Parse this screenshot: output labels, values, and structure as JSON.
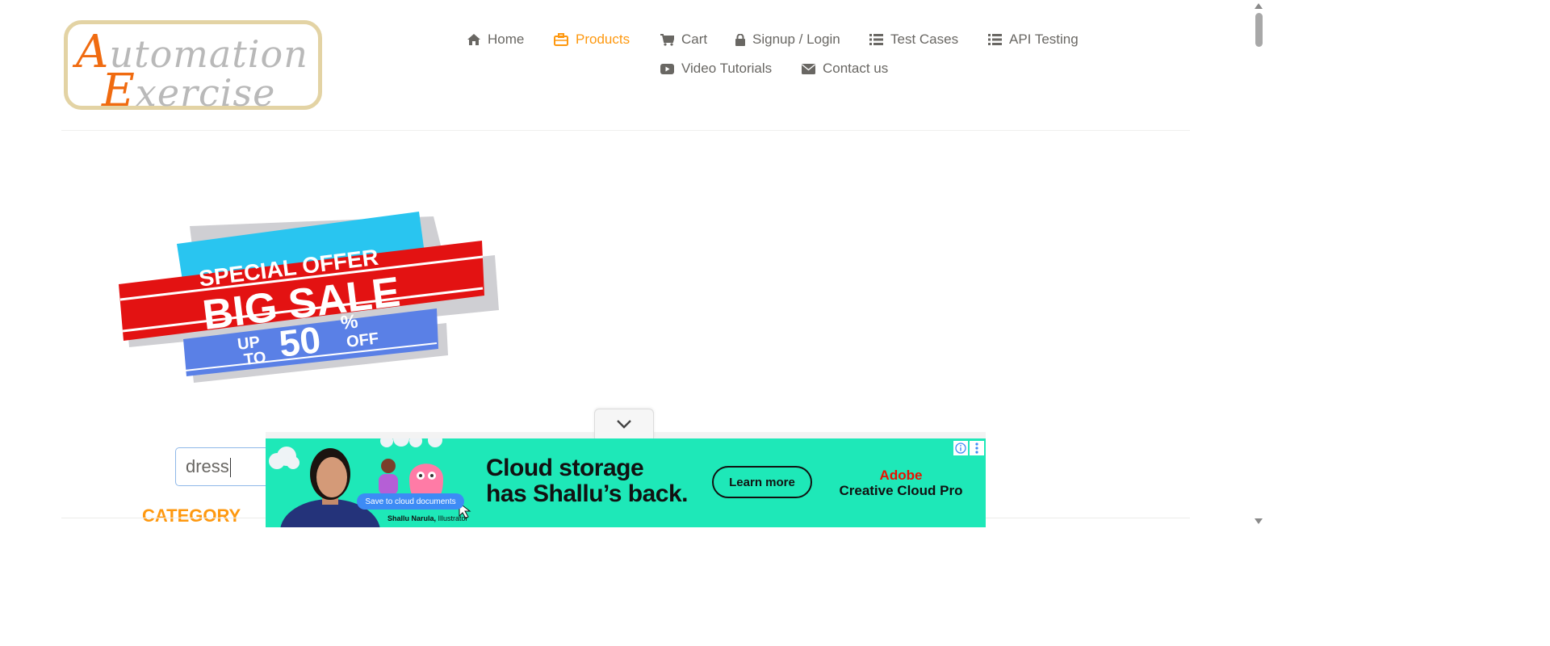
{
  "logo": {
    "line1_cap": "A",
    "line1_rest": "utomation",
    "line2_cap": "E",
    "line2_rest": "xercise"
  },
  "nav": {
    "items": [
      {
        "label": "Home",
        "icon": "home-icon"
      },
      {
        "label": "Products",
        "icon": "briefcase-icon",
        "active": true
      },
      {
        "label": "Cart",
        "icon": "cart-icon"
      },
      {
        "label": "Signup / Login",
        "icon": "lock-icon"
      },
      {
        "label": "Test Cases",
        "icon": "list-icon"
      },
      {
        "label": "API Testing",
        "icon": "list-icon"
      },
      {
        "label": "Video Tutorials",
        "icon": "youtube-play-icon"
      },
      {
        "label": "Contact us",
        "icon": "envelope-icon"
      }
    ]
  },
  "banner": {
    "special_offer": "SPECIAL OFFER",
    "big_sale": "BIG SALE",
    "up": "UP",
    "to": "TO",
    "fifty": "50",
    "percent": "%",
    "off": "OFF"
  },
  "search": {
    "value": "dress"
  },
  "sidebar": {
    "category_heading": "CATEGORY"
  },
  "ad": {
    "headline_line1": "Cloud storage",
    "headline_line2": "has Shallu’s back.",
    "cta": "Learn more",
    "brand_line1": "Adobe",
    "brand_line2": "Creative Cloud Pro",
    "chip": "Save to cloud documents",
    "credit_name": "Shallu Narula,",
    "credit_role": "Illustrator"
  },
  "colors": {
    "accent": "#FE980F",
    "text": "#696763",
    "ad_background": "#1EE8B8",
    "adobe_red": "#EB1000",
    "banner_cyan": "#29C5F0",
    "banner_red": "#E31212",
    "banner_blue": "#5A80E6"
  }
}
